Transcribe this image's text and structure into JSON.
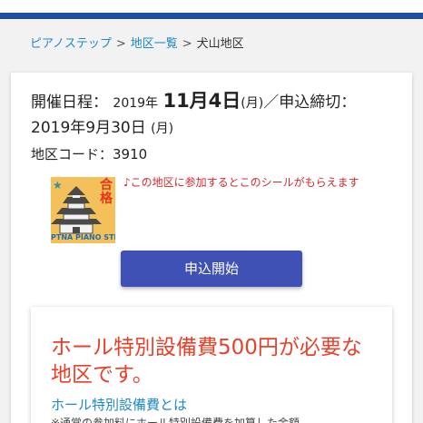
{
  "breadcrumb": {
    "items": [
      "ピアノステップ",
      "地区一覧"
    ],
    "separator": ">",
    "current": "犬山地区"
  },
  "event": {
    "label": "開催日程：",
    "date_prefix": "2019年",
    "date_main": "11月4日",
    "date_weekday": "(月)",
    "deadline_label": "／申込締切：",
    "deadline_date": "2019年9月30日",
    "deadline_weekday": "(月)"
  },
  "area_code": "地区コード：3910",
  "sticker": {
    "icon": "castle-sticker-icon",
    "kaku_text": "合格",
    "brand_text": "PTNA PIANO STEP"
  },
  "sticker_note": "♪この地区に参加するとこのシールがもらえます",
  "apply_button": "申込開始",
  "notice": {
    "title": "ホール特別設備費500円が必要な地区です。",
    "link": "ホール特別設備費とは",
    "body": "※通常の参加料にホール特別設備費を加算した金額"
  },
  "colors": {
    "header_stripe": "#1a4fa3",
    "link": "#1e88c8",
    "button": "#3f51b5",
    "notice_title": "#e8402a",
    "note_text": "#d22a2a",
    "sticker_bg": "#f4c05a"
  }
}
